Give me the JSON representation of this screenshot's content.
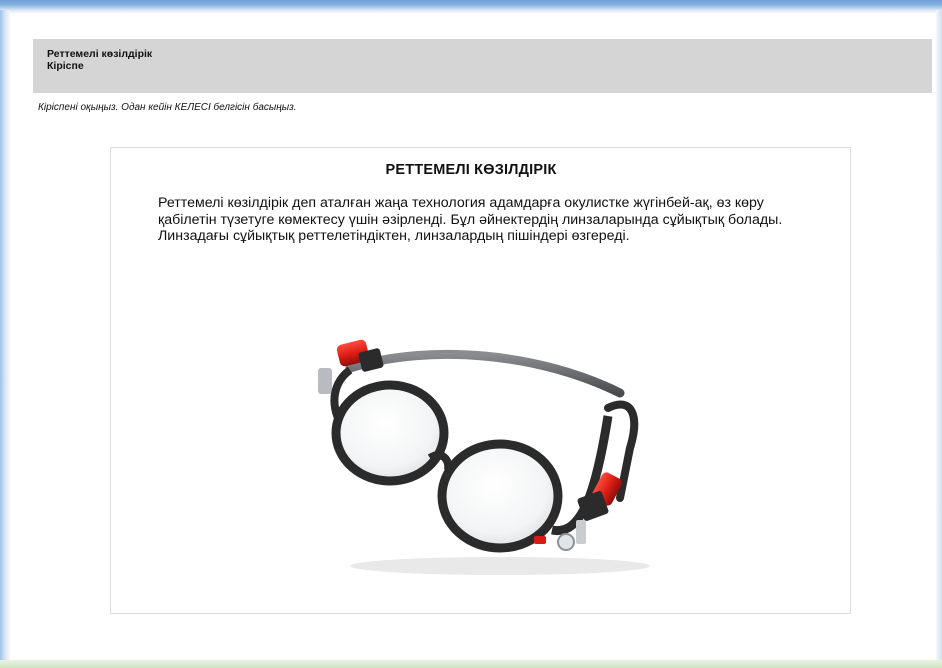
{
  "header": {
    "course_title": "Реттемелі көзілдірік",
    "section_title": "Кіріспе"
  },
  "instruction": "Кіріспені оқыңыз. Одан кейін КЕЛЕСІ белгісін басыңыз.",
  "card": {
    "title": "РЕТТЕМЕЛІ КӨЗІЛДІРІК",
    "body": "Реттемелі көзілдірік деп аталған жаңа технология адамдарға окулистке жүгінбей-ақ, өз көру қабілетін түзетуге көмектесу үшін әзірленді. Бұл әйнектердің линзаларында сұйықтық болады. Линзадағы сұйықтық реттелетіндіктен, линзалардың пішіндері өзгереді."
  },
  "image": {
    "subject": "adjustable-glasses",
    "frame_color": "#2b2b2b",
    "plunger_color": "#e01d1d"
  }
}
